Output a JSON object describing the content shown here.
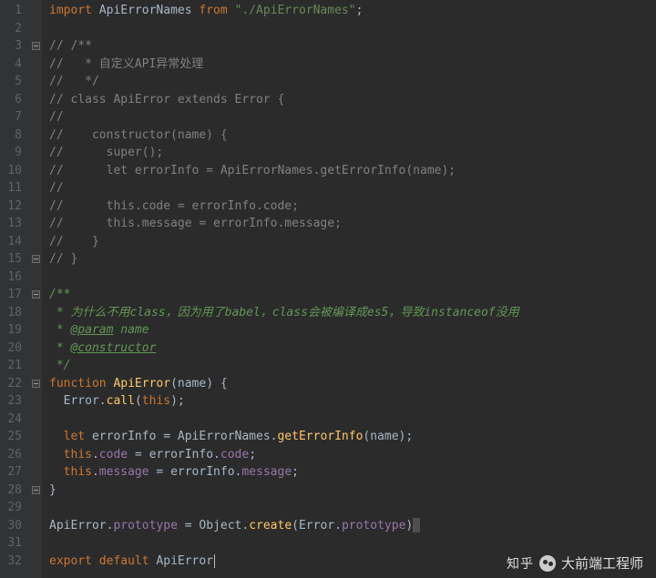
{
  "lineStart": 1,
  "lineEnd": 32,
  "foldMarkers": [
    3,
    15,
    17,
    22,
    28
  ],
  "watermark": {
    "brand": "知乎",
    "author": "大前端工程师"
  },
  "code": [
    {
      "n": 1,
      "seg": [
        [
          "kw",
          "import"
        ],
        [
          "pun",
          " "
        ],
        [
          "id",
          "ApiErrorNames"
        ],
        [
          "pun",
          " "
        ],
        [
          "kw",
          "from"
        ],
        [
          "pun",
          " "
        ],
        [
          "str",
          "\"./ApiErrorNames\""
        ],
        [
          "pun",
          ";"
        ]
      ]
    },
    {
      "n": 2,
      "seg": []
    },
    {
      "n": 3,
      "seg": [
        [
          "cmt",
          "// /**"
        ]
      ]
    },
    {
      "n": 4,
      "seg": [
        [
          "cmt",
          "//   * 自定义API异常处理"
        ]
      ]
    },
    {
      "n": 5,
      "seg": [
        [
          "cmt",
          "//   */"
        ]
      ]
    },
    {
      "n": 6,
      "seg": [
        [
          "cmt",
          "// class ApiError extends Error {"
        ]
      ]
    },
    {
      "n": 7,
      "seg": [
        [
          "cmt",
          "//"
        ]
      ]
    },
    {
      "n": 8,
      "seg": [
        [
          "cmt",
          "//    constructor(name) {"
        ]
      ]
    },
    {
      "n": 9,
      "seg": [
        [
          "cmt",
          "//      super();"
        ]
      ]
    },
    {
      "n": 10,
      "seg": [
        [
          "cmt",
          "//      let errorInfo = ApiErrorNames.getErrorInfo(name);"
        ]
      ]
    },
    {
      "n": 11,
      "seg": [
        [
          "cmt",
          "//"
        ]
      ]
    },
    {
      "n": 12,
      "seg": [
        [
          "cmt",
          "//      this.code = errorInfo.code;"
        ]
      ]
    },
    {
      "n": 13,
      "seg": [
        [
          "cmt",
          "//      this.message = errorInfo.message;"
        ]
      ]
    },
    {
      "n": 14,
      "seg": [
        [
          "cmt",
          "//    }"
        ]
      ]
    },
    {
      "n": 15,
      "seg": [
        [
          "cmt",
          "// }"
        ]
      ]
    },
    {
      "n": 16,
      "seg": []
    },
    {
      "n": 17,
      "seg": [
        [
          "doc",
          "/**"
        ]
      ]
    },
    {
      "n": 18,
      "seg": [
        [
          "doc",
          " * 为什么不用class，因为用了babel，class会被编译成es5，导致instanceof没用"
        ]
      ]
    },
    {
      "n": 19,
      "seg": [
        [
          "doc",
          " * "
        ],
        [
          "doct",
          "@param"
        ],
        [
          "doc",
          " name"
        ]
      ]
    },
    {
      "n": 20,
      "seg": [
        [
          "doc",
          " * "
        ],
        [
          "doct",
          "@constructor"
        ]
      ]
    },
    {
      "n": 21,
      "seg": [
        [
          "doc",
          " */"
        ]
      ]
    },
    {
      "n": 22,
      "seg": [
        [
          "kw",
          "function"
        ],
        [
          "pun",
          " "
        ],
        [
          "fn",
          "ApiError"
        ],
        [
          "pun",
          "("
        ],
        [
          "id",
          "name"
        ],
        [
          "pun",
          ") {"
        ]
      ]
    },
    {
      "n": 23,
      "seg": [
        [
          "pun",
          "  "
        ],
        [
          "id",
          "Error"
        ],
        [
          "pun",
          "."
        ],
        [
          "fn",
          "call"
        ],
        [
          "pun",
          "("
        ],
        [
          "kw",
          "this"
        ],
        [
          "pun",
          ");"
        ]
      ]
    },
    {
      "n": 24,
      "seg": []
    },
    {
      "n": 25,
      "seg": [
        [
          "pun",
          "  "
        ],
        [
          "kw",
          "let"
        ],
        [
          "pun",
          " "
        ],
        [
          "id",
          "errorInfo"
        ],
        [
          "pun",
          " = "
        ],
        [
          "id",
          "ApiErrorNames"
        ],
        [
          "pun",
          "."
        ],
        [
          "fn",
          "getErrorInfo"
        ],
        [
          "pun",
          "("
        ],
        [
          "id",
          "name"
        ],
        [
          "pun",
          ");"
        ]
      ]
    },
    {
      "n": 26,
      "seg": [
        [
          "pun",
          "  "
        ],
        [
          "kw",
          "this"
        ],
        [
          "pun",
          "."
        ],
        [
          "prop",
          "code"
        ],
        [
          "pun",
          " = "
        ],
        [
          "id",
          "errorInfo"
        ],
        [
          "pun",
          "."
        ],
        [
          "prop",
          "code"
        ],
        [
          "pun",
          ";"
        ]
      ]
    },
    {
      "n": 27,
      "seg": [
        [
          "pun",
          "  "
        ],
        [
          "kw",
          "this"
        ],
        [
          "pun",
          "."
        ],
        [
          "prop",
          "message"
        ],
        [
          "pun",
          " = "
        ],
        [
          "id",
          "errorInfo"
        ],
        [
          "pun",
          "."
        ],
        [
          "prop",
          "message"
        ],
        [
          "pun",
          ";"
        ]
      ]
    },
    {
      "n": 28,
      "seg": [
        [
          "pun",
          "}"
        ]
      ]
    },
    {
      "n": 29,
      "seg": []
    },
    {
      "n": 30,
      "seg": [
        [
          "id",
          "ApiError"
        ],
        [
          "pun",
          "."
        ],
        [
          "prop",
          "prototype"
        ],
        [
          "pun",
          " = "
        ],
        [
          "id",
          "Object"
        ],
        [
          "pun",
          "."
        ],
        [
          "fn",
          "create"
        ],
        [
          "pun",
          "("
        ],
        [
          "id",
          "Error"
        ],
        [
          "pun",
          "."
        ],
        [
          "prop",
          "prototype"
        ],
        [
          "pun",
          ")"
        ],
        [
          "hl",
          ""
        ]
      ]
    },
    {
      "n": 31,
      "seg": []
    },
    {
      "n": 32,
      "seg": [
        [
          "kw",
          "export"
        ],
        [
          "pun",
          " "
        ],
        [
          "kw",
          "default"
        ],
        [
          "pun",
          " "
        ],
        [
          "id",
          "ApiError"
        ],
        [
          "cursor",
          ""
        ]
      ]
    }
  ]
}
